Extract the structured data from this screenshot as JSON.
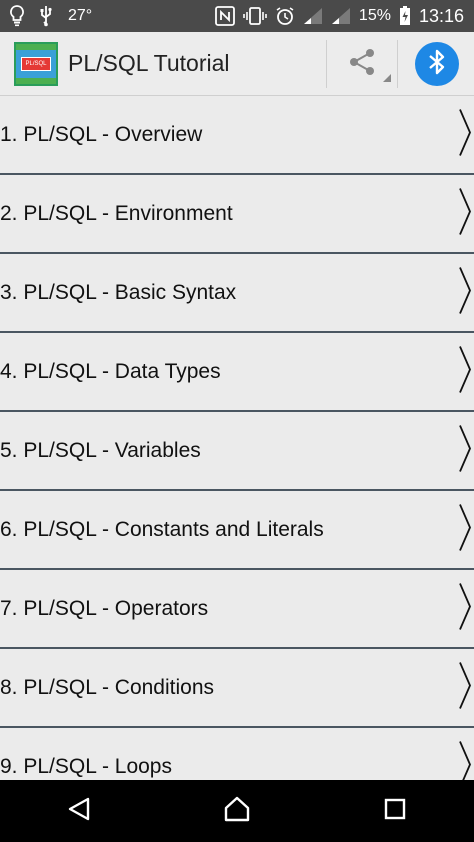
{
  "status_bar": {
    "temperature": "27°",
    "battery_percent": "15%",
    "time": "13:16"
  },
  "action_bar": {
    "title": "PL/SQL Tutorial",
    "app_icon_text": "PL/SQL"
  },
  "list": {
    "items": [
      {
        "label": "1. PL/SQL - Overview"
      },
      {
        "label": "2. PL/SQL - Environment"
      },
      {
        "label": "3. PL/SQL - Basic Syntax"
      },
      {
        "label": "4. PL/SQL - Data Types"
      },
      {
        "label": "5. PL/SQL - Variables"
      },
      {
        "label": "6. PL/SQL - Constants and Literals"
      },
      {
        "label": "7. PL/SQL - Operators"
      },
      {
        "label": "8. PL/SQL - Conditions"
      },
      {
        "label": "9. PL/SQL - Loops"
      }
    ]
  },
  "colors": {
    "status_bar": "#4a4a4a",
    "action_bar": "#ececec",
    "list_bg": "#ebebeb",
    "divider": "#4a5661",
    "bluetooth": "#1e88e5",
    "nav_bar": "#000000"
  }
}
